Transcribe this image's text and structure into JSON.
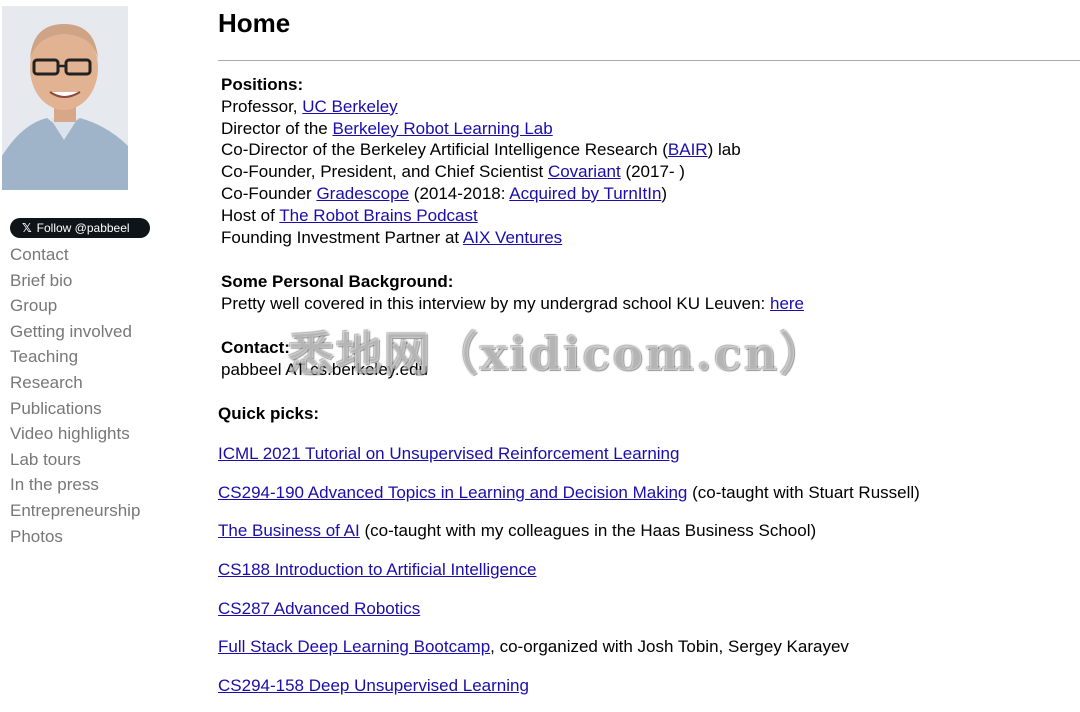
{
  "sidebar": {
    "follow_button": "Follow @pabbeel",
    "follow_icon": "x-logo",
    "nav": [
      "Contact",
      "Brief bio",
      "Group",
      "Getting involved",
      "Teaching",
      "Research",
      "Publications",
      "Video highlights",
      "Lab tours",
      "In the press",
      "Entrepreneurship",
      "Photos"
    ]
  },
  "main": {
    "title": "Home",
    "positions": {
      "heading": "Positions:",
      "l1": {
        "text": "Professor, ",
        "link": "UC Berkeley"
      },
      "l2": {
        "text": "Director of the ",
        "link": "Berkeley Robot Learning Lab"
      },
      "l3": {
        "text": "Co-Director of the Berkeley Artificial Intelligence Research (",
        "link": "BAIR",
        "after": ") lab"
      },
      "l4": {
        "text": "Co-Founder, President, and Chief Scientist ",
        "link": "Covariant",
        "after": " (2017- )"
      },
      "l5": {
        "text": "Co-Founder ",
        "link": "Gradescope",
        "mid": " (2014-2018: ",
        "link2": "Acquired by TurnItIn",
        "after": ")"
      },
      "l6": {
        "text": "Host of ",
        "link": "The Robot Brains Podcast"
      },
      "l7": {
        "text": "Founding Investment Partner at ",
        "link": "AIX Ventures"
      }
    },
    "background": {
      "heading": "Some Personal Background:",
      "text": "Pretty well covered in this interview by my undergrad school KU Leuven: ",
      "link": "here"
    },
    "contact": {
      "heading": "Contact:",
      "email": "pabbeel AT cs.berkeley.edu"
    },
    "quick_picks": {
      "title": "Quick picks:",
      "items": [
        {
          "link": "ICML 2021 Tutorial on Unsupervised Reinforcement Learning",
          "after": ""
        },
        {
          "link": "CS294-190 Advanced Topics in Learning and Decision Making",
          "after": " (co-taught with Stuart Russell)"
        },
        {
          "link": "The Business of AI",
          "after": " (co-taught with my colleagues in the Haas Business School)"
        },
        {
          "link": "CS188 Introduction to Artificial Intelligence",
          "after": ""
        },
        {
          "link": "CS287 Advanced Robotics",
          "after": ""
        },
        {
          "link": "Full Stack Deep Learning Bootcamp",
          "after": ", co-organized with Josh Tobin, Sergey Karayev"
        },
        {
          "link": "CS294-158 Deep Unsupervised Learning",
          "after": ""
        }
      ]
    }
  },
  "watermark": "悉地网（xidicom.cn）"
}
